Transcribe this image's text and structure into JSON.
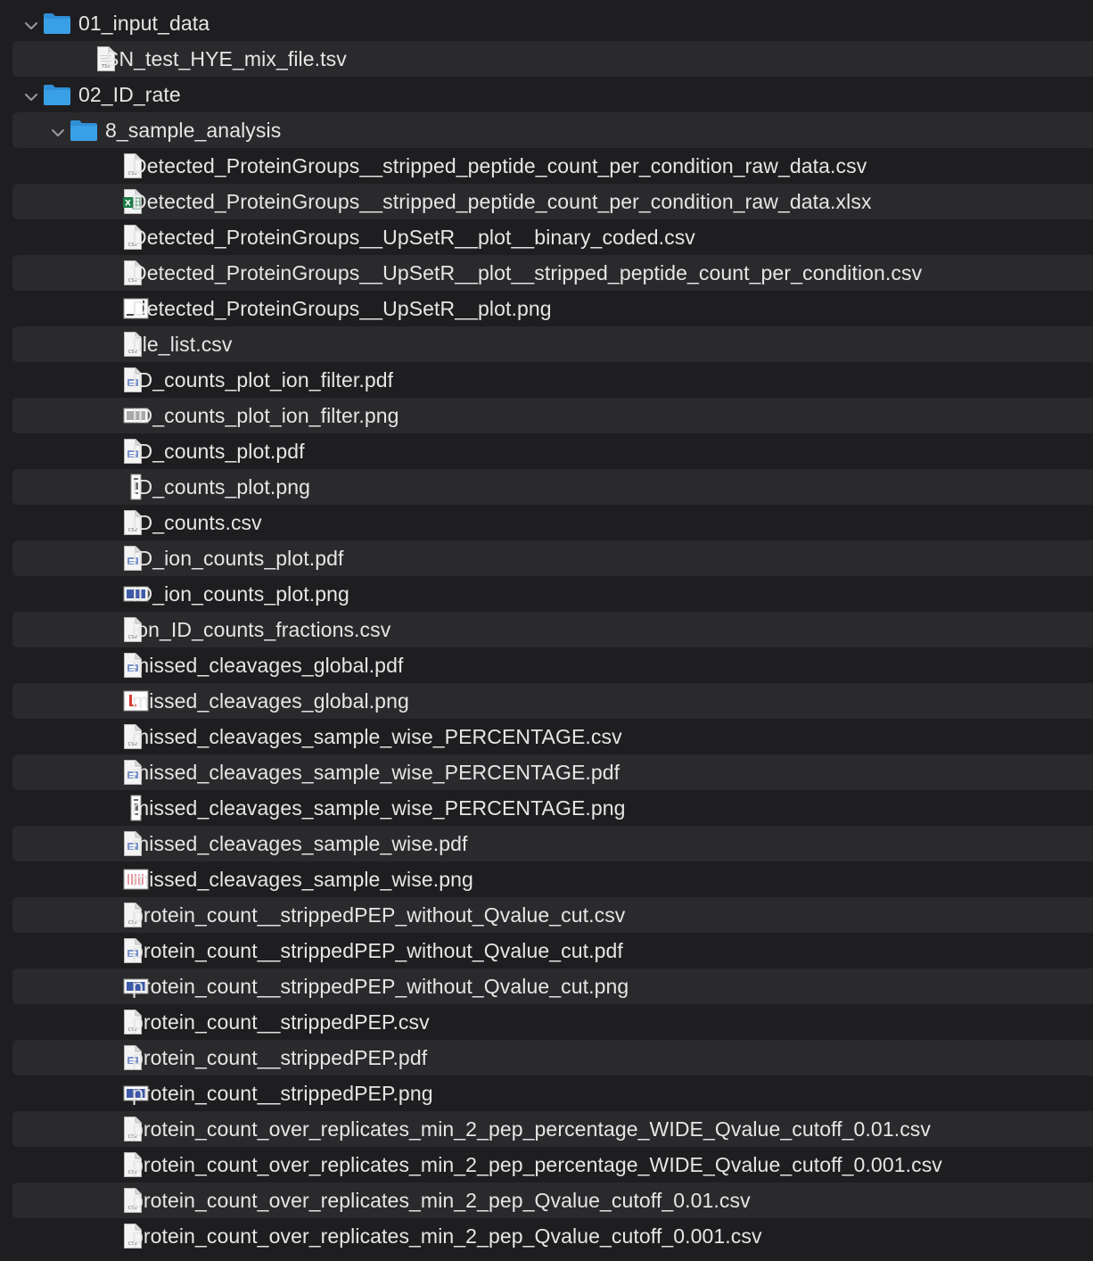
{
  "items": [
    {
      "label": "01_input_data",
      "kind": "folder",
      "level": 0,
      "expanded": true
    },
    {
      "label": "SN_test_HYE_mix_file.tsv",
      "kind": "tsv",
      "level": 1
    },
    {
      "label": "02_ID_rate",
      "kind": "folder",
      "level": 0,
      "expanded": true
    },
    {
      "label": "8_sample_analysis",
      "kind": "folder",
      "level": 1,
      "expanded": true
    },
    {
      "label": "Detected_ProteinGroups__stripped_peptide_count_per_condition_raw_data.csv",
      "kind": "csv",
      "level": 2
    },
    {
      "label": "Detected_ProteinGroups__stripped_peptide_count_per_condition_raw_data.xlsx",
      "kind": "xlsx",
      "level": 2
    },
    {
      "label": "Detected_ProteinGroups__UpSetR__plot__binary_coded.csv",
      "kind": "csv",
      "level": 2
    },
    {
      "label": "Detected_ProteinGroups__UpSetR__plot__stripped_peptide_count_per_condition.csv",
      "kind": "csv",
      "level": 2
    },
    {
      "label": "Detected_ProteinGroups__UpSetR__plot.png",
      "kind": "png-upset",
      "level": 2
    },
    {
      "label": "file_list.csv",
      "kind": "csv",
      "level": 2
    },
    {
      "label": "ID_counts_plot_ion_filter.pdf",
      "kind": "pdf",
      "level": 2
    },
    {
      "label": "ID_counts_plot_ion_filter.png",
      "kind": "png-wide-gray",
      "level": 2
    },
    {
      "label": "ID_counts_plot.pdf",
      "kind": "pdf",
      "level": 2
    },
    {
      "label": "ID_counts_plot.png",
      "kind": "png-tall",
      "level": 2
    },
    {
      "label": "ID_counts.csv",
      "kind": "csv",
      "level": 2
    },
    {
      "label": "ID_ion_counts_plot.pdf",
      "kind": "pdf",
      "level": 2
    },
    {
      "label": "ID_ion_counts_plot.png",
      "kind": "png-wide-blue",
      "level": 2
    },
    {
      "label": "ion_ID_counts_fractions.csv",
      "kind": "csv",
      "level": 2
    },
    {
      "label": "missed_cleavages_global.pdf",
      "kind": "pdf",
      "level": 2
    },
    {
      "label": "missed_cleavages_global.png",
      "kind": "png-red",
      "level": 2
    },
    {
      "label": "missed_cleavages_sample_wise_PERCENTAGE.csv",
      "kind": "csv",
      "level": 2
    },
    {
      "label": "missed_cleavages_sample_wise_PERCENTAGE.pdf",
      "kind": "pdf",
      "level": 2
    },
    {
      "label": "missed_cleavages_sample_wise_PERCENTAGE.png",
      "kind": "png-tall",
      "level": 2
    },
    {
      "label": "missed_cleavages_sample_wise.pdf",
      "kind": "pdf",
      "level": 2
    },
    {
      "label": "missed_cleavages_sample_wise.png",
      "kind": "png-pink",
      "level": 2
    },
    {
      "label": "protein_count__strippedPEP_without_Qvalue_cut.csv",
      "kind": "csv",
      "level": 2
    },
    {
      "label": "protein_count__strippedPEP_without_Qvalue_cut.pdf",
      "kind": "pdf",
      "level": 2
    },
    {
      "label": "protein_count__strippedPEP_without_Qvalue_cut.png",
      "kind": "png-wide-blue",
      "level": 2
    },
    {
      "label": "protein_count__strippedPEP.csv",
      "kind": "csv",
      "level": 2
    },
    {
      "label": "protein_count__strippedPEP.pdf",
      "kind": "pdf",
      "level": 2
    },
    {
      "label": "protein_count__strippedPEP.png",
      "kind": "png-wide-blue",
      "level": 2
    },
    {
      "label": "protein_count_over_replicates_min_2_pep_percentage_WIDE_Qvalue_cutoff_0.01.csv",
      "kind": "csv",
      "level": 2
    },
    {
      "label": "protein_count_over_replicates_min_2_pep_percentage_WIDE_Qvalue_cutoff_0.001.csv",
      "kind": "csv",
      "level": 2
    },
    {
      "label": "protein_count_over_replicates_min_2_pep_Qvalue_cutoff_0.01.csv",
      "kind": "csv",
      "level": 2
    },
    {
      "label": "protein_count_over_replicates_min_2_pep_Qvalue_cutoff_0.001.csv",
      "kind": "csv",
      "level": 2
    }
  ],
  "icon_text": {
    "csv": "CSV",
    "tsv": "TSV",
    "xlsx": "X"
  },
  "colors": {
    "background": "#1e1e20",
    "row_alt": "#2a2a2d",
    "text": "#e6e6e6",
    "folder": "#3aa0e6",
    "chevron": "#9a9a9e"
  }
}
